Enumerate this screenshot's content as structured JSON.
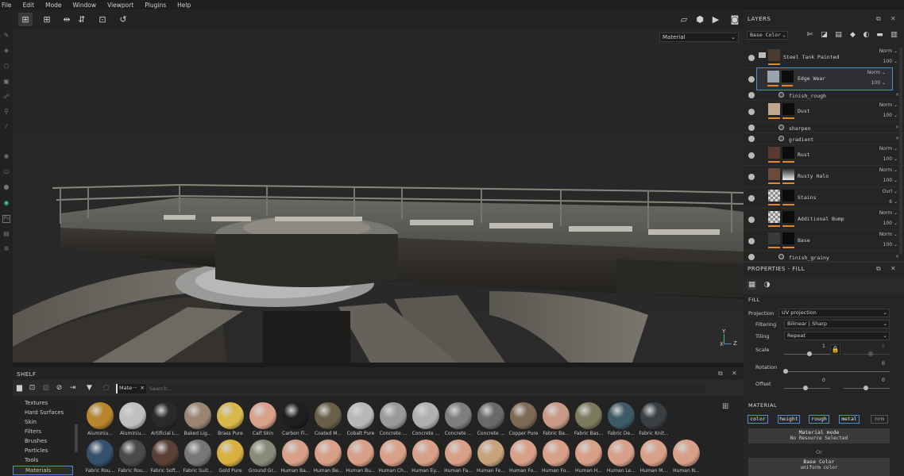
{
  "menu": [
    "File",
    "Edit",
    "Mode",
    "Window",
    "Viewport",
    "Plugins",
    "Help"
  ],
  "viewport": {
    "material_mode": "Material",
    "axis": {
      "x": "X",
      "y": "Y",
      "z": "Z"
    }
  },
  "layers": {
    "title": "LAYERS",
    "channel": "Base Color",
    "items": [
      {
        "name": "Steel Tank Painted",
        "blend": "Norm",
        "opacity": "100",
        "kind": "folder"
      },
      {
        "name": "Edge Wear",
        "blend": "Norm",
        "opacity": "100",
        "kind": "fill",
        "selected": true
      },
      {
        "name": "finish_rough",
        "kind": "effect"
      },
      {
        "name": "Dust",
        "blend": "Norm",
        "opacity": "100",
        "kind": "fill"
      },
      {
        "name": "sharpen",
        "kind": "effect"
      },
      {
        "name": "gradient",
        "kind": "effect"
      },
      {
        "name": "Rust",
        "blend": "Norm",
        "opacity": "100",
        "kind": "fill"
      },
      {
        "name": "Rusty Halo",
        "blend": "Norm",
        "opacity": "100",
        "kind": "fill"
      },
      {
        "name": "Stains",
        "blend": "Ovrl",
        "opacity": "6",
        "kind": "fill"
      },
      {
        "name": "Additional Bump",
        "blend": "Norm",
        "opacity": "100",
        "kind": "fill"
      },
      {
        "name": "Base",
        "blend": "Norm",
        "opacity": "100",
        "kind": "fill"
      },
      {
        "name": "finish_grainy",
        "kind": "effect"
      }
    ]
  },
  "properties": {
    "title": "PROPERTIES - FILL",
    "fill_header": "FILL",
    "projection_label": "Projection",
    "projection_value": "UV projection",
    "filtering_label": "Filtering",
    "filtering_value": "Bilinear | Sharp",
    "tiling_label": "Tiling",
    "tiling_value": "Repeat",
    "scale_label": "Scale",
    "scale_value": "1",
    "scale_value2": "1",
    "rotation_label": "Rotation",
    "rotation_value": "0",
    "offset_label": "Offset",
    "offset_value1": "0",
    "offset_value2": "0",
    "material_header": "MATERIAL",
    "channels": [
      "color",
      "height",
      "rough",
      "metal",
      "nrm"
    ],
    "material_mode_label": "Material mode",
    "material_mode_value": "No Resource Selected",
    "or_label": "Or",
    "base_color_label": "Base Color",
    "base_color_value": "uniform color"
  },
  "shelf": {
    "title": "SHELF",
    "filter_chip": "Mate···",
    "search_placeholder": "Search...",
    "categories": [
      "Textures",
      "Hard Surfaces",
      "Skin",
      "Filters",
      "Brushes",
      "Particles",
      "Tools",
      "Materials"
    ],
    "selected_category": "Materials",
    "materials_row1": [
      "Aluminiu...",
      "Aluminiu...",
      "Artificial L...",
      "Baked Lig...",
      "Brass Pure",
      "Calf Skin",
      "Carbon Fi...",
      "Coated M...",
      "Cobalt Pure",
      "Concrete ...",
      "Concrete ...",
      "Concrete ...",
      "Concrete ...",
      "Copper Pure",
      "Fabric Ba...",
      "Fabric Bas...",
      "Fabric De...",
      "Fabric Knit..."
    ],
    "materials_row2": [
      "Fabric Rou...",
      "Fabric Rou...",
      "Fabric Soft...",
      "Fabric Suit...",
      "Gold Pure",
      "Ground Gr...",
      "Human Ba...",
      "Human Be...",
      "Human Bu...",
      "Human Ch...",
      "Human Ey...",
      "Human Fa...",
      "Human Fe...",
      "Human Fo...",
      "Human Fo...",
      "Human H...",
      "Human Le...",
      "Human M...",
      "Human N..."
    ],
    "colors_row1": [
      "#b8842c",
      "#bfbfbf",
      "#2a2a2a",
      "#9a8570",
      "#d8b84a",
      "#d9a08a",
      "#1e1e1e",
      "#6a6048",
      "#b7b7b7",
      "#9a9a9a",
      "#b0b0b0",
      "#7e7e7e",
      "#6a6a6a",
      "#7d6a55",
      "#c89a86",
      "#7c7a5c",
      "#3e5a66",
      "#3a3f44",
      "#c8c8c8"
    ],
    "colors_row2": [
      "#35506b",
      "#4a4a4a",
      "#5a4035",
      "#777777",
      "#d8b040",
      "#8a8a7a",
      "#d8a088",
      "#d8a088",
      "#d8a088",
      "#d8a088",
      "#d8a088",
      "#d8a088",
      "#c8a27a",
      "#d8a088",
      "#d8a088",
      "#d8a088",
      "#d8a088",
      "#d8a088",
      "#d8a088"
    ]
  }
}
